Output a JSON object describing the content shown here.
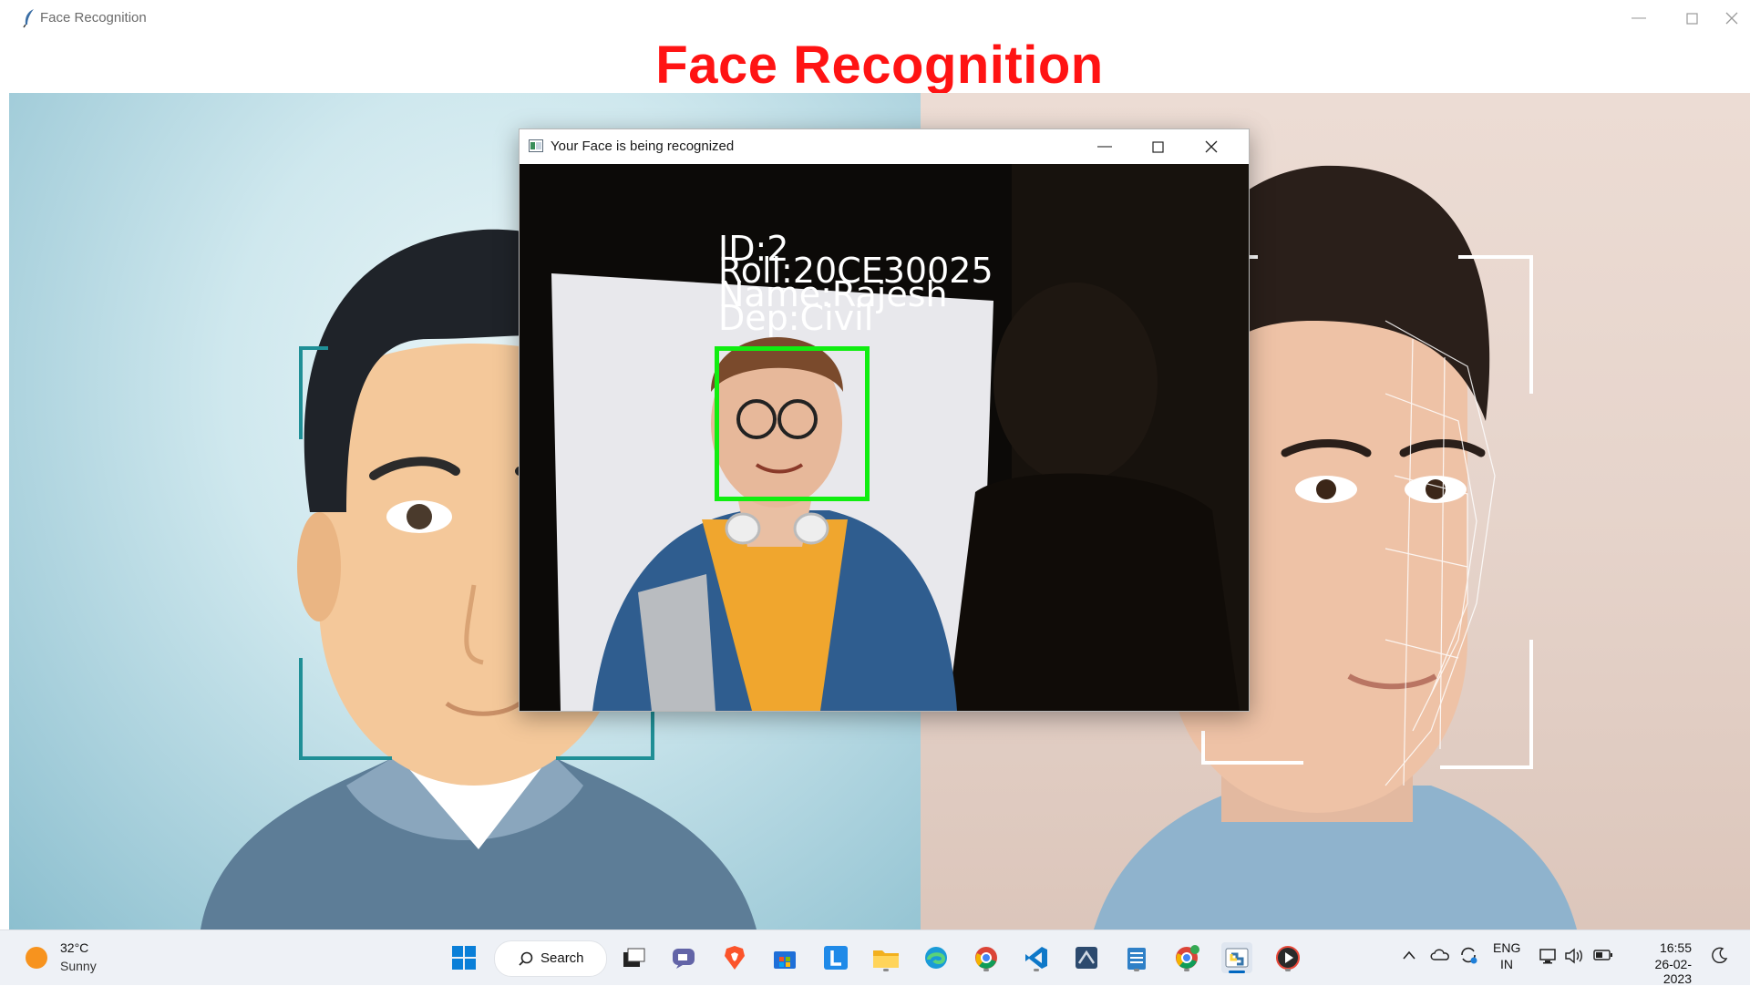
{
  "main_window": {
    "title": "Face Recognition",
    "heading": "Face Recognition"
  },
  "popup": {
    "title": "Your Face is being recognized",
    "overlay": {
      "id_text": "ID:2",
      "roll_text": "Roll:20CE30025",
      "name_text": "Name:Rajesh",
      "dep_text": "Dep:Civil"
    },
    "box_color": "#10ee10"
  },
  "colors": {
    "heading": "#ff1313",
    "accent": "#0067c0"
  },
  "taskbar": {
    "weather": {
      "temp": "32°C",
      "condition": "Sunny",
      "icon": "sun-icon"
    },
    "search_label": "Search",
    "apps": [
      "windows-start-icon",
      "search-icon",
      "task-view-icon",
      "chat-icon",
      "brave-browser-icon",
      "microsoft-store-icon",
      "l-app-icon",
      "file-explorer-icon",
      "edge-browser-icon",
      "chrome-icon",
      "vscode-icon",
      "visual-studio-icon",
      "notepad-icon",
      "chrome-profile-icon",
      "python-icon",
      "media-player-icon"
    ],
    "tray": {
      "language_line1": "ENG",
      "language_line2": "IN",
      "time": "16:55",
      "date": "26-02-2023"
    }
  }
}
